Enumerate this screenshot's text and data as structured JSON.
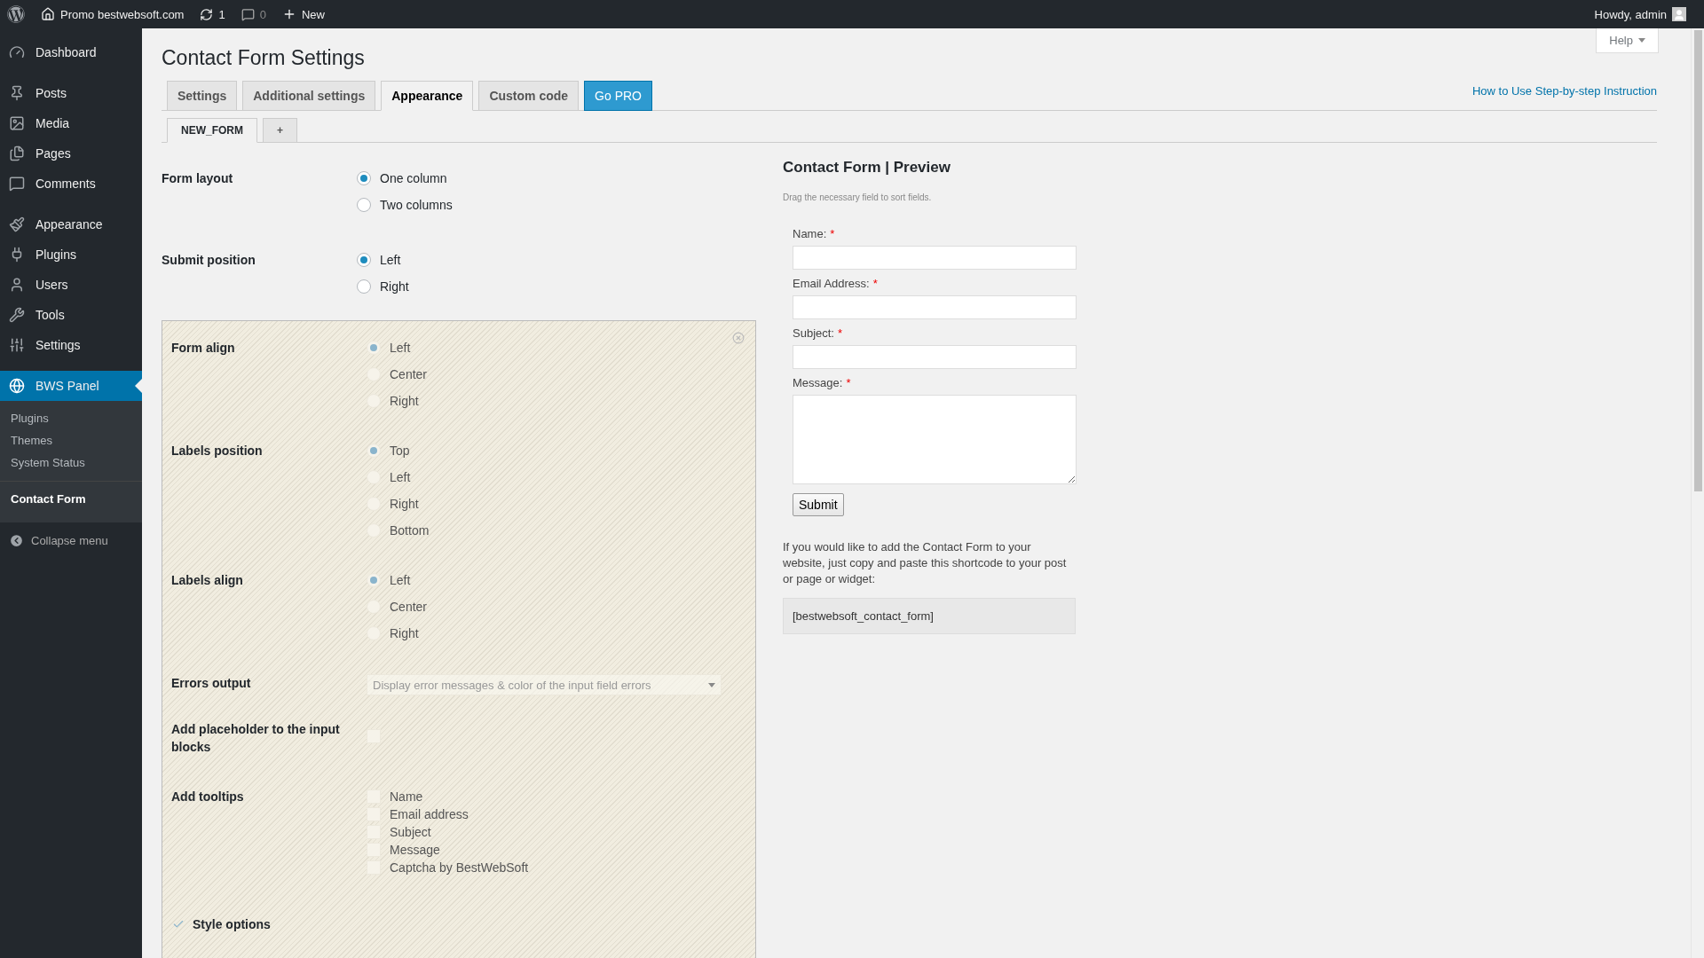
{
  "admin_bar": {
    "site": "Promo bestwebsoft.com",
    "updates": "1",
    "comments": "0",
    "new": "New",
    "greeting": "Howdy, admin"
  },
  "sidebar": {
    "items": [
      {
        "label": "Dashboard",
        "selected": false
      },
      {
        "label": "Posts",
        "selected": false
      },
      {
        "label": "Media",
        "selected": false
      },
      {
        "label": "Pages",
        "selected": false
      },
      {
        "label": "Comments",
        "selected": false
      },
      {
        "label": "Appearance",
        "selected": false
      },
      {
        "label": "Plugins",
        "selected": false
      },
      {
        "label": "Users",
        "selected": false
      },
      {
        "label": "Tools",
        "selected": false
      },
      {
        "label": "Settings",
        "selected": false
      },
      {
        "label": "BWS Panel",
        "selected": true,
        "children": [
          {
            "label": "Plugins",
            "selected": false
          },
          {
            "label": "Themes",
            "selected": false
          },
          {
            "label": "System Status",
            "selected": false
          },
          {
            "label": "Contact Form",
            "selected": true
          }
        ]
      }
    ],
    "collapse": "Collapse menu"
  },
  "help": "Help",
  "title": "Contact Form Settings",
  "tabs": [
    {
      "label": "Settings",
      "selected": false,
      "kind": "tab"
    },
    {
      "label": "Additional settings",
      "selected": false,
      "kind": "tab"
    },
    {
      "label": "Appearance",
      "selected": true,
      "kind": "tab"
    },
    {
      "label": "Custom code",
      "selected": false,
      "kind": "tab"
    },
    {
      "label": "Go PRO",
      "selected": false,
      "kind": "pro"
    }
  ],
  "instruction_link": "How to Use Step-by-step Instruction",
  "form_tabs": [
    {
      "label": "NEW_FORM",
      "selected": true
    },
    {
      "label": "+",
      "selected": false
    }
  ],
  "settings": [
    {
      "label": "Form layout",
      "kind": "radio",
      "options": [
        {
          "label": "One column",
          "selected": true
        },
        {
          "label": "Two columns",
          "selected": false
        }
      ]
    },
    {
      "label": "Submit position",
      "kind": "radio",
      "options": [
        {
          "label": "Left",
          "selected": true
        },
        {
          "label": "Right",
          "selected": false
        }
      ]
    }
  ],
  "pro_box": {
    "disabled": true,
    "rows": [
      {
        "label": "Form align",
        "kind": "radio",
        "options": [
          {
            "label": "Left",
            "selected": true
          },
          {
            "label": "Center",
            "selected": false
          },
          {
            "label": "Right",
            "selected": false
          }
        ]
      },
      {
        "label": "Labels position",
        "kind": "radio",
        "options": [
          {
            "label": "Top",
            "selected": true
          },
          {
            "label": "Left",
            "selected": false
          },
          {
            "label": "Right",
            "selected": false
          },
          {
            "label": "Bottom",
            "selected": false
          }
        ]
      },
      {
        "label": "Labels align",
        "kind": "radio",
        "options": [
          {
            "label": "Left",
            "selected": true
          },
          {
            "label": "Center",
            "selected": false
          },
          {
            "label": "Right",
            "selected": false
          }
        ]
      },
      {
        "label": "Errors output",
        "kind": "select",
        "value": "Display error messages & color of the input field errors"
      },
      {
        "label": "Add placeholder to the input blocks",
        "kind": "checkbox",
        "checked": false
      },
      {
        "label": "Add tooltips",
        "kind": "checklist",
        "options": [
          {
            "label": "Name",
            "checked": false
          },
          {
            "label": "Email address",
            "checked": false
          },
          {
            "label": "Subject",
            "checked": false
          },
          {
            "label": "Message",
            "checked": false
          },
          {
            "label": "Captcha by BestWebSoft",
            "checked": false
          }
        ]
      }
    ],
    "style_options": {
      "label": "Style options",
      "checked": true
    }
  },
  "preview": {
    "title": "Contact Form | Preview",
    "hint": "Drag the necessary field to sort fields.",
    "fields": [
      {
        "label": "Name:",
        "kind": "input",
        "required_mark": "*"
      },
      {
        "label": "Email Address:",
        "kind": "input",
        "required_mark": "*"
      },
      {
        "label": "Subject:",
        "kind": "input",
        "required_mark": "*"
      },
      {
        "label": "Message:",
        "kind": "textarea",
        "required_mark": "*"
      }
    ],
    "submit": "Submit",
    "note": "If you would like to add the Contact Form to your website, just copy and paste this shortcode to your post or page or widget:",
    "shortcode": "[bestwebsoft_contact_form]"
  }
}
